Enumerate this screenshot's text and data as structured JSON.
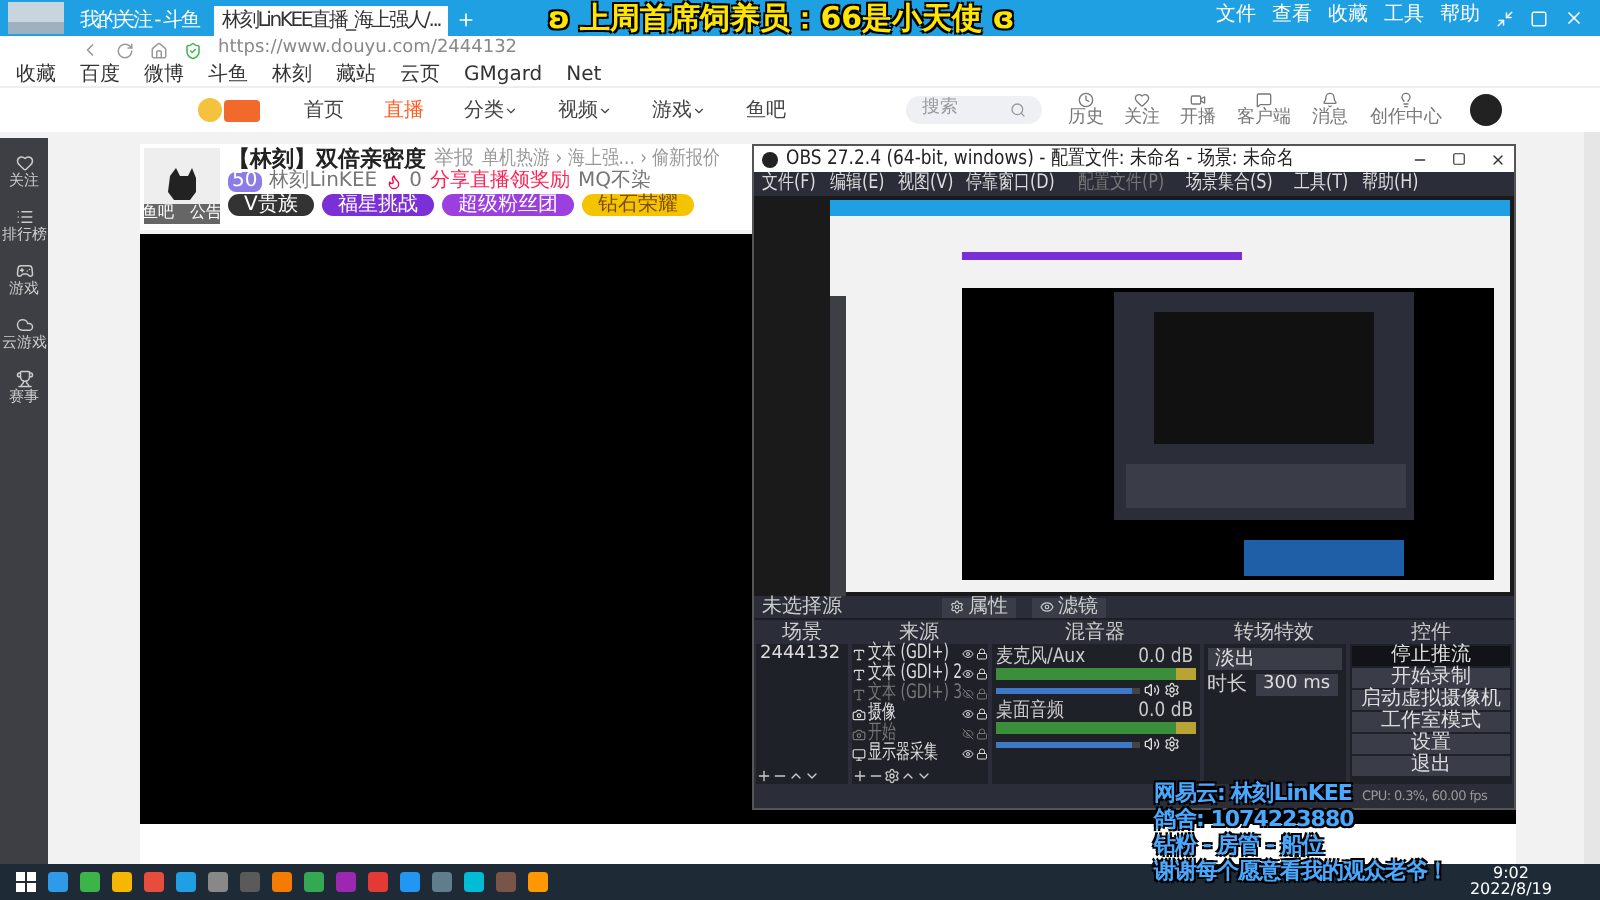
{
  "browser": {
    "tabs": [
      {
        "title": "我的关注 - 斗鱼",
        "selected": false
      },
      {
        "title": "林刻LinKEE直播_海上强人/...",
        "selected": true
      }
    ],
    "menu": [
      "文件",
      "查看",
      "收藏",
      "工具",
      "帮助"
    ],
    "url": "https://www.douyu.com/2444132",
    "bookmarks": [
      "收藏",
      "百度",
      "微博",
      "斗鱼",
      "林刻",
      "藏站",
      "云页",
      "GMgard",
      "Net"
    ]
  },
  "banner": "ʚ 上周首席饲养员：66是小天使 ɞ",
  "site": {
    "nav": [
      {
        "label": "首页",
        "selected": false,
        "dropdown": false
      },
      {
        "label": "直播",
        "selected": true,
        "dropdown": false
      },
      {
        "label": "分类",
        "selected": false,
        "dropdown": true
      },
      {
        "label": "视频",
        "selected": false,
        "dropdown": true
      },
      {
        "label": "游戏",
        "selected": false,
        "dropdown": true
      },
      {
        "label": "鱼吧",
        "selected": false,
        "dropdown": false
      }
    ],
    "search": {
      "placeholder": "搜索"
    },
    "actions": [
      {
        "label": "历史",
        "kind": "clock"
      },
      {
        "label": "关注",
        "kind": "heart"
      },
      {
        "label": "开播",
        "kind": "video"
      },
      {
        "label": "客户端",
        "kind": "chat"
      },
      {
        "label": "消息",
        "kind": "bell"
      },
      {
        "label": "创作中心",
        "kind": "bulb"
      }
    ]
  },
  "sidebar": [
    {
      "label": "关注",
      "kind": "heart"
    },
    {
      "label": "排行榜",
      "kind": "list"
    },
    {
      "label": "游戏",
      "kind": "game"
    },
    {
      "label": "云游戏",
      "kind": "cloud"
    },
    {
      "label": "赛事",
      "kind": "trophy"
    }
  ],
  "room": {
    "title": "【林刻】双倍亲密度",
    "report": "举报",
    "breadcrumb": "单机热游 › 海上强... › 偷新报价",
    "level": "50",
    "anchor": "林刻LinKEE",
    "hot": "0",
    "share": "分享直播领奖励",
    "follow": "MQ不染",
    "avatar_links": [
      "鱼吧",
      "公告"
    ],
    "badges": [
      {
        "label": "V贵族",
        "color": "#333333"
      },
      {
        "label": "福星挑战",
        "color": "#7b2fd6"
      },
      {
        "label": "超级粉丝团",
        "color": "#9b3fe0"
      },
      {
        "label": "钻石荣耀",
        "color": "#f5c400"
      }
    ]
  },
  "obs": {
    "title": "OBS 27.2.4 (64-bit, windows) - 配置文件: 未命名 - 场景: 未命名",
    "menu": [
      {
        "label": "文件(F)",
        "disabled": false
      },
      {
        "label": "编辑(E)",
        "disabled": false
      },
      {
        "label": "视图(V)",
        "disabled": false
      },
      {
        "label": "停靠窗口(D)",
        "disabled": false
      },
      {
        "label": "配置文件(P)",
        "disabled": true
      },
      {
        "label": "场景集合(S)",
        "disabled": false
      },
      {
        "label": "工具(T)",
        "disabled": false
      },
      {
        "label": "帮助(H)",
        "disabled": false
      }
    ],
    "source_bar": {
      "label": "未选择源",
      "buttons": [
        "属性",
        "滤镜"
      ]
    },
    "panels": [
      "场景",
      "来源",
      "混音器",
      "转场特效",
      "控件"
    ],
    "scenes": [
      {
        "name": "2444132",
        "selected": false
      }
    ],
    "sources": [
      {
        "name": "文本 (GDI+)",
        "kind": "text",
        "visible": true
      },
      {
        "name": "文本 (GDI+) 2",
        "kind": "text",
        "visible": true
      },
      {
        "name": "文本 (GDI+) 3",
        "kind": "text",
        "visible": false
      },
      {
        "name": "摄像",
        "kind": "camera",
        "visible": true
      },
      {
        "name": "开始",
        "kind": "camera",
        "visible": false
      },
      {
        "name": "显示器采集",
        "kind": "display",
        "visible": true
      }
    ],
    "mixer": [
      {
        "name": "麦克风/Aux",
        "reading": "0.0 dB",
        "level": 0.95
      },
      {
        "name": "桌面音频",
        "reading": "0.0 dB",
        "level": 0.95
      }
    ],
    "transition": {
      "effect": "淡出",
      "duration_label": "时长",
      "duration": "300 ms"
    },
    "controls": [
      {
        "label": "停止推流",
        "active": true
      },
      {
        "label": "开始录制",
        "active": false
      },
      {
        "label": "启动虚拟摄像机",
        "active": false
      },
      {
        "label": "工作室模式",
        "active": false
      },
      {
        "label": "设置",
        "active": false
      },
      {
        "label": "退出",
        "active": false
      }
    ],
    "status": "CPU: 0.3%, 60.00 fps"
  },
  "overlay": [
    "网易云: 林刻LinKEE",
    "鸽舍: 1074223880",
    "钻粉 - 房管 - 船位",
    "谢谢每个愿意看我的观众老爷！"
  ],
  "taskbar": {
    "time": "9:02",
    "date": "2022/8/19"
  }
}
